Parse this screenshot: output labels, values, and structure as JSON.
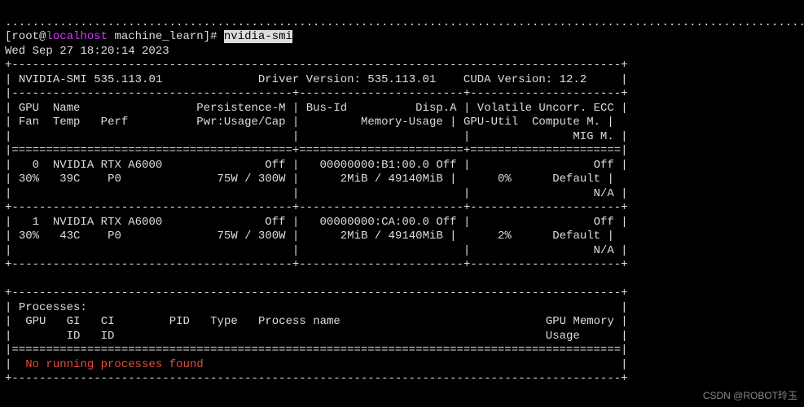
{
  "prompt": {
    "dots": "........................................................................................................................",
    "user": "root",
    "at": "@",
    "host": "localhost",
    "cwd": "machine_learn",
    "command": "nvidia-smi"
  },
  "timestamp": "Wed Sep 27 18:20:14 2023",
  "header": {
    "smi_version": "NVIDIA-SMI 535.113.01",
    "driver_version": "Driver Version: 535.113.01",
    "cuda_version": "CUDA Version: 12.2"
  },
  "cols": {
    "gpu": "GPU",
    "name": "Name",
    "persist": "Persistence-M",
    "busid": "Bus-Id",
    "dispa": "Disp.A",
    "volatile": "Volatile Uncorr. ECC",
    "fan": "Fan",
    "temp": "Temp",
    "perf": "Perf",
    "pwr": "Pwr:Usage/Cap",
    "memusage": "Memory-Usage",
    "gpuutil": "GPU-Util",
    "compute": "Compute M.",
    "mig": "MIG M."
  },
  "gpus": [
    {
      "id": "0",
      "name": "NVIDIA RTX A6000",
      "persist": "Off",
      "busid": "00000000:B1:00.0",
      "dispa": "Off",
      "ecc": "Off",
      "fan": "30%",
      "temp": "39C",
      "perf": "P0",
      "pwr": "75W / 300W",
      "mem": "2MiB / 49140MiB",
      "util": "0%",
      "compute": "Default",
      "mig": "N/A"
    },
    {
      "id": "1",
      "name": "NVIDIA RTX A6000",
      "persist": "Off",
      "busid": "00000000:CA:00.0",
      "dispa": "Off",
      "ecc": "Off",
      "fan": "30%",
      "temp": "43C",
      "perf": "P0",
      "pwr": "75W / 300W",
      "mem": "2MiB / 49140MiB",
      "util": "2%",
      "compute": "Default",
      "mig": "N/A"
    }
  ],
  "proc": {
    "title": "Processes:",
    "gpu": "GPU",
    "gi": "GI",
    "ci": "CI",
    "pid": "PID",
    "type": "Type",
    "pname": "Process name",
    "gpumem": "GPU Memory",
    "id": "ID",
    "usage": "Usage",
    "none": "No running processes found"
  },
  "watermark": "CSDN @ROBOT玲玉"
}
